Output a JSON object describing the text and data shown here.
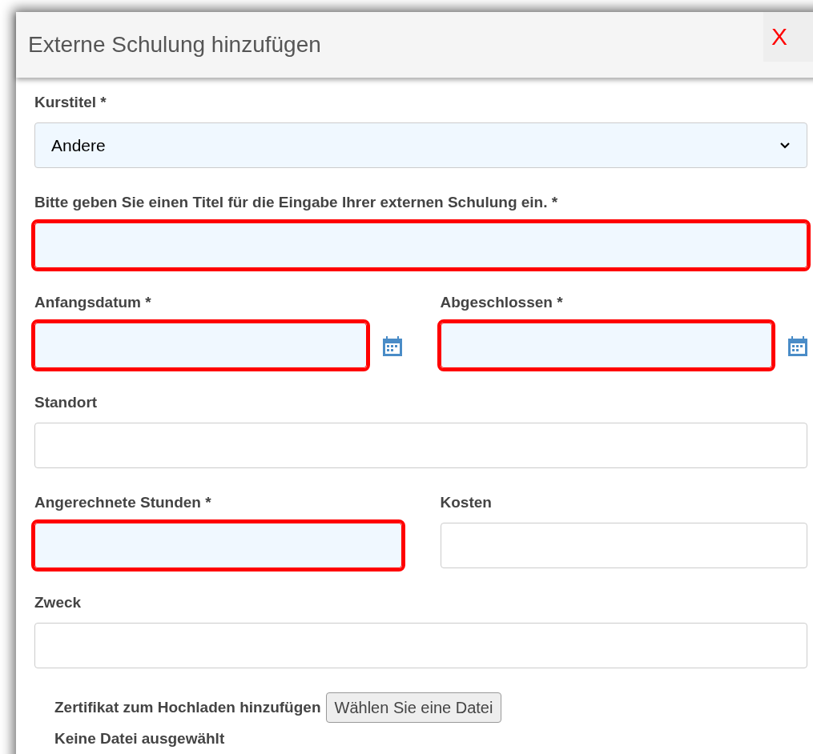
{
  "dialog": {
    "title": "Externe Schulung hinzufügen",
    "close": "X"
  },
  "rows": [
    {
      "fields": [
        {
          "kind": "select",
          "label": "Kurstitel *",
          "value": "Andere",
          "invalid": false
        }
      ]
    },
    {
      "fields": [
        {
          "kind": "text",
          "label": "Bitte geben Sie einen Titel für die Eingabe Ihrer externen Schulung ein. *",
          "invalid": true
        }
      ]
    },
    {
      "fields": [
        {
          "kind": "date",
          "label": "Anfangsdatum *",
          "invalid": true
        },
        {
          "kind": "date",
          "label": "Abgeschlossen *",
          "invalid": true
        }
      ]
    },
    {
      "fields": [
        {
          "kind": "text",
          "label": "Standort",
          "invalid": false
        }
      ]
    },
    {
      "fields": [
        {
          "kind": "text",
          "label": "Angerechnete Stunden *",
          "invalid": true
        },
        {
          "kind": "text",
          "label": "Kosten",
          "invalid": false
        }
      ]
    },
    {
      "fields": [
        {
          "kind": "text",
          "label": "Zweck",
          "invalid": false
        }
      ]
    }
  ],
  "upload": {
    "label": "Zertifikat zum Hochladen hinzufügen",
    "button": "Wählen Sie eine Datei",
    "status": "Keine Datei ausgewählt"
  }
}
